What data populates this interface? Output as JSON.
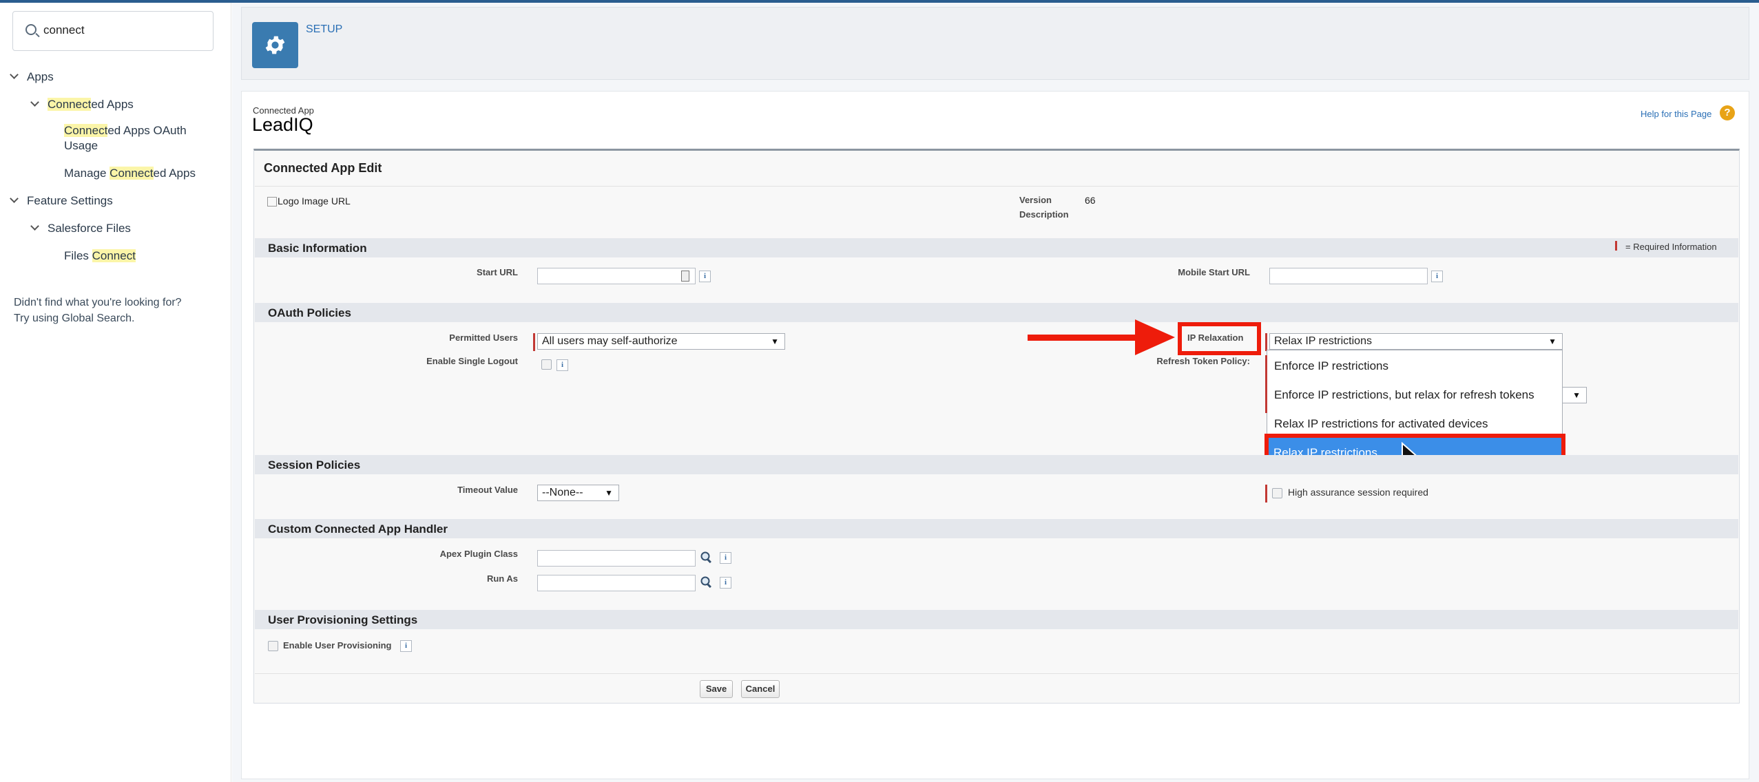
{
  "sidebar": {
    "search_value": "connect",
    "tree": {
      "apps": "Apps",
      "connected_apps_hl": "Connect",
      "connected_apps_rest": "ed Apps",
      "oauth_usage_hl": "Connect",
      "oauth_usage_rest1": "ed Apps OAuth",
      "oauth_usage_rest2": "Usage",
      "manage_pre": "Manage ",
      "manage_hl": "Connect",
      "manage_rest": "ed Apps",
      "feature_settings": "Feature Settings",
      "salesforce_files": "Salesforce Files",
      "files_pre": "Files ",
      "files_hl": "Connect"
    },
    "not_found_line1": "Didn't find what you're looking for?",
    "not_found_line2": "Try using Global Search."
  },
  "header": {
    "setup_label": "SETUP"
  },
  "page": {
    "subtitle": "Connected App",
    "title": "LeadIQ",
    "help_link": "Help for this Page",
    "help_icon": "?"
  },
  "edit": {
    "heading": "Connected App Edit",
    "logo_alt": "Logo Image URL",
    "version_label": "Version",
    "version_value": "66",
    "description_label": "Description"
  },
  "basic_info": {
    "title": "Basic Information",
    "required_note": "= Required Information",
    "start_url_label": "Start URL",
    "mobile_start_url_label": "Mobile Start URL"
  },
  "oauth": {
    "title": "OAuth Policies",
    "permitted_users_label": "Permitted Users",
    "permitted_users_value": "All users may self-authorize",
    "enable_single_logout_label": "Enable Single Logout",
    "ip_relaxation_label": "IP Relaxation",
    "ip_relaxation_value": "Relax IP restrictions",
    "refresh_token_label": "Refresh Token Policy:",
    "dropdown_options": [
      "Enforce IP restrictions",
      "Enforce IP restrictions, but relax for refresh tokens",
      "Relax IP restrictions for activated devices",
      "Relax IP restrictions"
    ]
  },
  "session": {
    "title": "Session Policies",
    "timeout_label": "Timeout Value",
    "timeout_value": "--None--",
    "high_assurance_label": "High assurance session required"
  },
  "handler": {
    "title": "Custom Connected App Handler",
    "apex_label": "Apex Plugin Class",
    "run_as_label": "Run As"
  },
  "provisioning": {
    "title": "User Provisioning Settings",
    "enable_label": "Enable User Provisioning"
  },
  "buttons": {
    "save": "Save",
    "cancel": "Cancel"
  },
  "colors": {
    "highlight": "#ee1c0b",
    "selected_option": "#3b8ee8",
    "required": "#c23934",
    "link": "#2a6fb5"
  },
  "icons": [
    "search-icon",
    "chevron-down-icon",
    "gear-icon",
    "help-icon",
    "info-icon",
    "lookup-icon",
    "red-arrow-icon",
    "mouse-cursor-icon"
  ]
}
